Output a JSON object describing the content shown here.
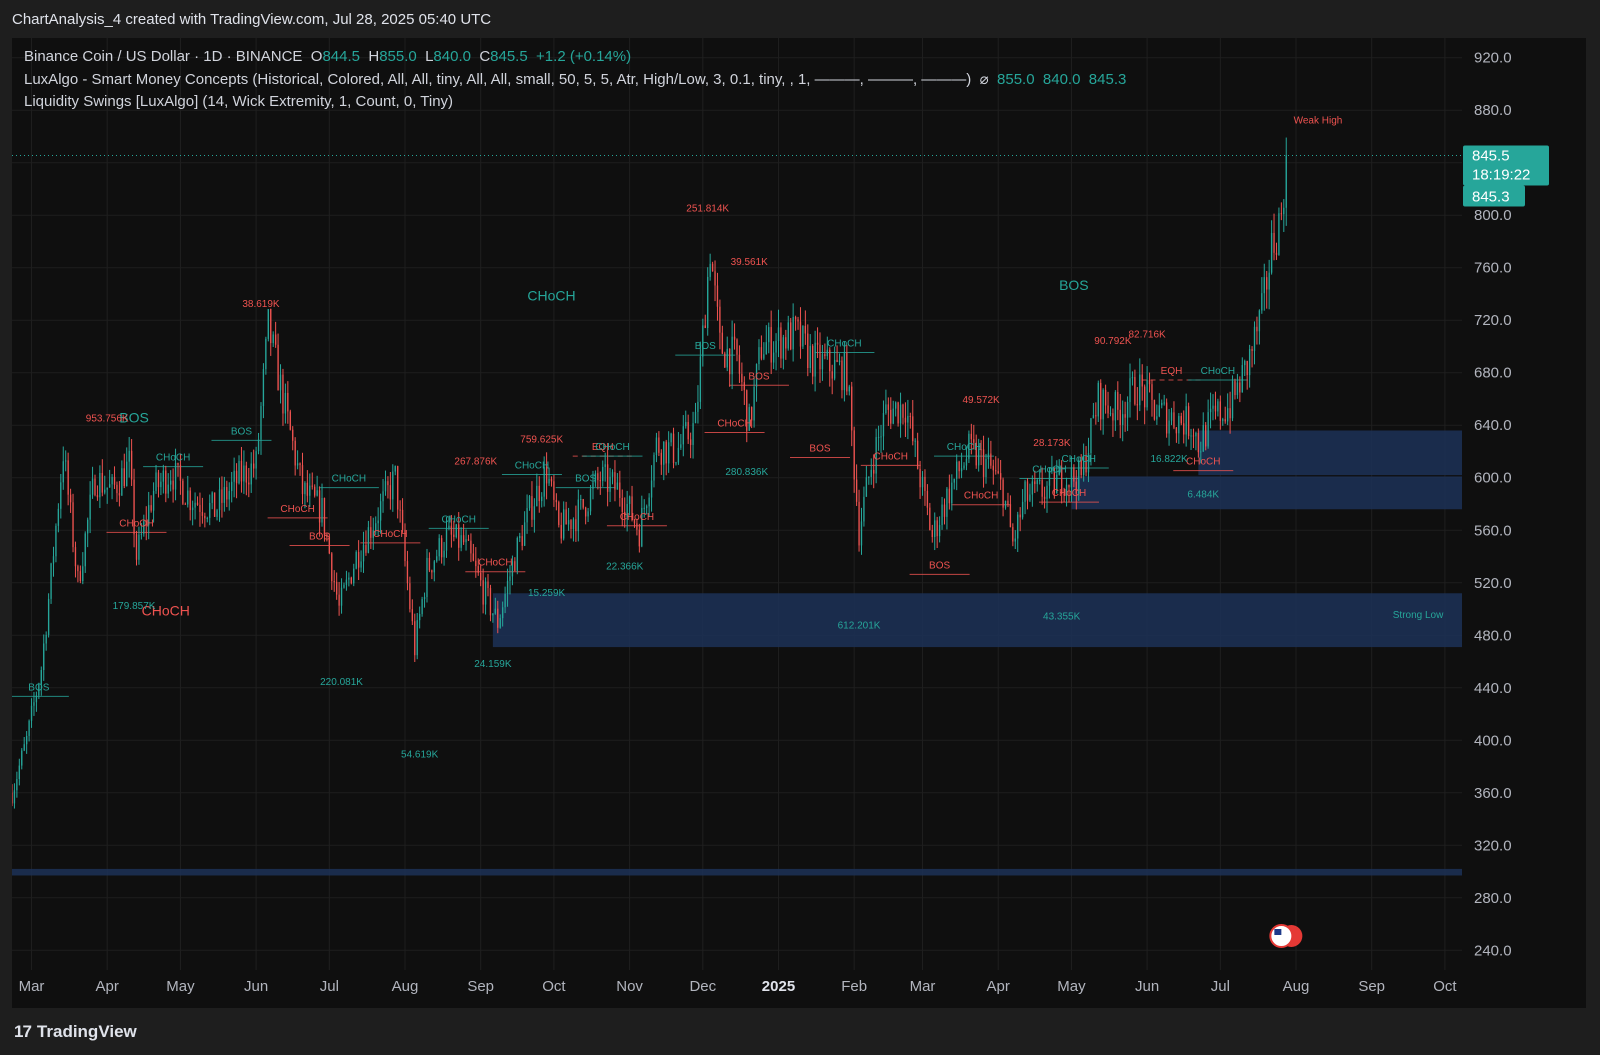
{
  "header": {
    "title": "ChartAnalysis_4 created with TradingView.com, Jul 28, 2025 05:40 UTC"
  },
  "legend": {
    "symbol": "Binance Coin / US Dollar · 1D · BINANCE",
    "open_label": "O",
    "open": "844.5",
    "high_label": "H",
    "high": "855.0",
    "low_label": "L",
    "low": "840.0",
    "close_label": "C",
    "close": "845.5",
    "change": "+1.2 (+0.14%)",
    "indicator1": "LuxAlgo - Smart Money Concepts (Historical, Colored, All, All, tiny, All, All, small, 50, 5, 5, Atr, High/Low, 3, 0.1, tiny, , 1, ———, ———, ———)",
    "indicator1_symbol": "⌀",
    "indicator1_values": [
      "855.0",
      "840.0",
      "845.3"
    ],
    "indicator2": "Liquidity Swings [LuxAlgo] (14, Wick Extremity, 1, Count, 0, Tiny)"
  },
  "price_badge": {
    "price": "845.5",
    "countdown": "18:19:22",
    "indicator_price": "845.3"
  },
  "footer": {
    "brand": "TradingView",
    "logo": "17"
  },
  "colors": {
    "up": "#26a69a",
    "down": "#ef5350",
    "zone": "#1c3157",
    "bg": "#0f0f0f",
    "grid": "#1f1f1f"
  },
  "chart_data": {
    "type": "candlestick",
    "symbol": "BNB/USD",
    "interval": "1D",
    "x_range": [
      "2024-02-22",
      "2025-10-08"
    ],
    "ylim": [
      225,
      935
    ],
    "y_ticks": [
      "920.0",
      "880.0",
      "840.0",
      "800.0",
      "760.0",
      "720.0",
      "680.0",
      "640.0",
      "600.0",
      "560.0",
      "520.0",
      "480.0",
      "440.0",
      "400.0",
      "360.0",
      "320.0",
      "280.0",
      "240.0"
    ],
    "y_tick_values": [
      920,
      880,
      840,
      800,
      760,
      720,
      680,
      640,
      600,
      560,
      520,
      480,
      440,
      400,
      360,
      320,
      280,
      240
    ],
    "x_ticks": [
      {
        "label": "Mar",
        "date": "2024-03-01"
      },
      {
        "label": "Apr",
        "date": "2024-04-01"
      },
      {
        "label": "May",
        "date": "2024-05-01"
      },
      {
        "label": "Jun",
        "date": "2024-06-01"
      },
      {
        "label": "Jul",
        "date": "2024-07-01"
      },
      {
        "label": "Aug",
        "date": "2024-08-01"
      },
      {
        "label": "Sep",
        "date": "2024-09-01"
      },
      {
        "label": "Oct",
        "date": "2024-10-01"
      },
      {
        "label": "Nov",
        "date": "2024-11-01"
      },
      {
        "label": "Dec",
        "date": "2024-12-01"
      },
      {
        "label": "2025",
        "date": "2025-01-01",
        "bold": true
      },
      {
        "label": "Feb",
        "date": "2025-02-01"
      },
      {
        "label": "Mar",
        "date": "2025-03-01"
      },
      {
        "label": "Apr",
        "date": "2025-04-01"
      },
      {
        "label": "May",
        "date": "2025-05-01"
      },
      {
        "label": "Jun",
        "date": "2025-06-01"
      },
      {
        "label": "Jul",
        "date": "2025-07-01"
      },
      {
        "label": "Aug",
        "date": "2025-08-01"
      },
      {
        "label": "Sep",
        "date": "2025-09-01"
      },
      {
        "label": "Oct",
        "date": "2025-10-01"
      }
    ],
    "last_price": 845.5,
    "price_path": [
      [
        "2024-02-22",
        360
      ],
      [
        "2024-02-28",
        400
      ],
      [
        "2024-03-05",
        455
      ],
      [
        "2024-03-09",
        525
      ],
      [
        "2024-03-14",
        620
      ],
      [
        "2024-03-20",
        520
      ],
      [
        "2024-03-27",
        600
      ],
      [
        "2024-04-03",
        590
      ],
      [
        "2024-04-10",
        610
      ],
      [
        "2024-04-13",
        540
      ],
      [
        "2024-04-20",
        590
      ],
      [
        "2024-04-27",
        605
      ],
      [
        "2024-05-05",
        585
      ],
      [
        "2024-05-15",
        575
      ],
      [
        "2024-05-25",
        600
      ],
      [
        "2024-06-01",
        610
      ],
      [
        "2024-06-06",
        715
      ],
      [
        "2024-06-12",
        660
      ],
      [
        "2024-06-20",
        590
      ],
      [
        "2024-06-28",
        575
      ],
      [
        "2024-07-05",
        500
      ],
      [
        "2024-07-12",
        540
      ],
      [
        "2024-07-20",
        570
      ],
      [
        "2024-07-28",
        600
      ],
      [
        "2024-08-05",
        470
      ],
      [
        "2024-08-10",
        530
      ],
      [
        "2024-08-18",
        555
      ],
      [
        "2024-08-25",
        550
      ],
      [
        "2024-09-03",
        510
      ],
      [
        "2024-09-08",
        490
      ],
      [
        "2024-09-15",
        540
      ],
      [
        "2024-09-22",
        580
      ],
      [
        "2024-09-28",
        605
      ],
      [
        "2024-10-03",
        560
      ],
      [
        "2024-10-12",
        575
      ],
      [
        "2024-10-20",
        600
      ],
      [
        "2024-10-28",
        590
      ],
      [
        "2024-11-05",
        560
      ],
      [
        "2024-11-12",
        625
      ],
      [
        "2024-11-20",
        620
      ],
      [
        "2024-11-28",
        640
      ],
      [
        "2024-12-04",
        775
      ],
      [
        "2024-12-08",
        700
      ],
      [
        "2024-12-15",
        690
      ],
      [
        "2024-12-20",
        640
      ],
      [
        "2024-12-25",
        700
      ],
      [
        "2025-01-02",
        705
      ],
      [
        "2025-01-08",
        710
      ],
      [
        "2025-01-15",
        690
      ],
      [
        "2025-01-22",
        685
      ],
      [
        "2025-01-29",
        680
      ],
      [
        "2025-02-03",
        560
      ],
      [
        "2025-02-08",
        610
      ],
      [
        "2025-02-14",
        650
      ],
      [
        "2025-02-22",
        655
      ],
      [
        "2025-02-28",
        600
      ],
      [
        "2025-03-05",
        555
      ],
      [
        "2025-03-12",
        590
      ],
      [
        "2025-03-20",
        620
      ],
      [
        "2025-03-28",
        610
      ],
      [
        "2025-04-03",
        590
      ],
      [
        "2025-04-07",
        550
      ],
      [
        "2025-04-12",
        585
      ],
      [
        "2025-04-20",
        590
      ],
      [
        "2025-04-27",
        600
      ],
      [
        "2025-05-05",
        600
      ],
      [
        "2025-05-12",
        660
      ],
      [
        "2025-05-20",
        650
      ],
      [
        "2025-05-28",
        670
      ],
      [
        "2025-06-05",
        650
      ],
      [
        "2025-06-13",
        645
      ],
      [
        "2025-06-20",
        640
      ],
      [
        "2025-06-22",
        625
      ],
      [
        "2025-06-28",
        645
      ],
      [
        "2025-07-05",
        655
      ],
      [
        "2025-07-12",
        685
      ],
      [
        "2025-07-18",
        725
      ],
      [
        "2025-07-22",
        775
      ],
      [
        "2025-07-26",
        800
      ],
      [
        "2025-07-28",
        845.5
      ]
    ],
    "annotations": [
      {
        "date": "2024-04-12",
        "price": 642,
        "text": "BOS",
        "color": "up",
        "size": "big"
      },
      {
        "date": "2024-04-25",
        "price": 495,
        "text": "CHoCH",
        "color": "down",
        "size": "big"
      },
      {
        "date": "2024-09-30",
        "price": 735,
        "text": "CHoCH",
        "color": "up",
        "size": "big"
      },
      {
        "date": "2025-05-02",
        "price": 743,
        "text": "BOS",
        "color": "up",
        "size": "big"
      },
      {
        "date": "2024-03-04",
        "price": 438,
        "text": "BOS",
        "color": "up"
      },
      {
        "date": "2024-04-13",
        "price": 563,
        "text": "CHoCH",
        "color": "down"
      },
      {
        "date": "2024-04-28",
        "price": 613,
        "text": "CHoCH",
        "color": "up"
      },
      {
        "date": "2024-05-26",
        "price": 633,
        "text": "BOS",
        "color": "up"
      },
      {
        "date": "2024-06-18",
        "price": 574,
        "text": "CHoCH",
        "color": "down"
      },
      {
        "date": "2024-06-27",
        "price": 553,
        "text": "BOS",
        "color": "down"
      },
      {
        "date": "2024-07-09",
        "price": 597,
        "text": "CHoCH",
        "color": "up"
      },
      {
        "date": "2024-07-26",
        "price": 555,
        "text": "CHoCH",
        "color": "down"
      },
      {
        "date": "2024-08-23",
        "price": 566,
        "text": "CHoCH",
        "color": "up"
      },
      {
        "date": "2024-09-07",
        "price": 533,
        "text": "CHoCH",
        "color": "down"
      },
      {
        "date": "2024-09-22",
        "price": 607,
        "text": "CHoCH",
        "color": "up"
      },
      {
        "date": "2024-10-21",
        "price": 621,
        "text": "EQH",
        "color": "down"
      },
      {
        "date": "2024-10-14",
        "price": 597,
        "text": "BOS",
        "color": "up"
      },
      {
        "date": "2024-10-25",
        "price": 621,
        "text": "CHoCH",
        "color": "up"
      },
      {
        "date": "2024-11-04",
        "price": 568,
        "text": "CHoCH",
        "color": "down"
      },
      {
        "date": "2024-12-02",
        "price": 698,
        "text": "BOS",
        "color": "up"
      },
      {
        "date": "2024-12-14",
        "price": 639,
        "text": "CHoCH",
        "color": "down"
      },
      {
        "date": "2024-12-24",
        "price": 675,
        "text": "BOS",
        "color": "down"
      },
      {
        "date": "2025-01-18",
        "price": 620,
        "text": "BOS",
        "color": "down"
      },
      {
        "date": "2025-01-28",
        "price": 700,
        "text": "CHoCH",
        "color": "up"
      },
      {
        "date": "2025-02-16",
        "price": 614,
        "text": "CHoCH",
        "color": "down"
      },
      {
        "date": "2025-03-18",
        "price": 621,
        "text": "CHoCH",
        "color": "up"
      },
      {
        "date": "2025-03-08",
        "price": 531,
        "text": "BOS",
        "color": "down"
      },
      {
        "date": "2025-03-25",
        "price": 584,
        "text": "CHoCH",
        "color": "down"
      },
      {
        "date": "2025-04-22",
        "price": 604,
        "text": "CHoCH",
        "color": "up"
      },
      {
        "date": "2025-05-04",
        "price": 612,
        "text": "CHoCH",
        "color": "up"
      },
      {
        "date": "2025-04-30",
        "price": 586,
        "text": "CHoCH",
        "color": "down"
      },
      {
        "date": "2025-06-11",
        "price": 679,
        "text": "EQH",
        "color": "down"
      },
      {
        "date": "2025-06-30",
        "price": 679,
        "text": "CHoCH",
        "color": "up"
      },
      {
        "date": "2025-06-24",
        "price": 610,
        "text": "CHoCH",
        "color": "down"
      }
    ],
    "liquidity_labels": [
      {
        "date": "2024-06-03",
        "price": 730,
        "text": "38.619K",
        "color": "down"
      },
      {
        "date": "2024-04-01",
        "price": 643,
        "text": "953.756K",
        "color": "down"
      },
      {
        "date": "2024-04-12",
        "price": 500,
        "text": "179.857K",
        "color": "up"
      },
      {
        "date": "2024-07-06",
        "price": 442,
        "text": "220.081K",
        "color": "up"
      },
      {
        "date": "2024-08-07",
        "price": 387,
        "text": "54.619K",
        "color": "up"
      },
      {
        "date": "2024-08-30",
        "price": 610,
        "text": "267.876K",
        "color": "down"
      },
      {
        "date": "2024-09-06",
        "price": 456,
        "text": "24.159K",
        "color": "up"
      },
      {
        "date": "2024-09-28",
        "price": 510,
        "text": "15.259K",
        "color": "up"
      },
      {
        "date": "2024-09-26",
        "price": 627,
        "text": "759.625K",
        "color": "down"
      },
      {
        "date": "2024-10-30",
        "price": 530,
        "text": "22.366K",
        "color": "up"
      },
      {
        "date": "2024-12-03",
        "price": 803,
        "text": "251.814K",
        "color": "down"
      },
      {
        "date": "2024-12-20",
        "price": 762,
        "text": "39.561K",
        "color": "down"
      },
      {
        "date": "2024-12-19",
        "price": 602,
        "text": "280.836K",
        "color": "up"
      },
      {
        "date": "2025-02-03",
        "price": 485,
        "text": "612.201K",
        "color": "up"
      },
      {
        "date": "2025-03-25",
        "price": 657,
        "text": "49.572K",
        "color": "down"
      },
      {
        "date": "2025-04-27",
        "price": 492,
        "text": "43.355K",
        "color": "up"
      },
      {
        "date": "2025-04-23",
        "price": 624,
        "text": "28.173K",
        "color": "down"
      },
      {
        "date": "2025-05-18",
        "price": 702,
        "text": "90.792K",
        "color": "down"
      },
      {
        "date": "2025-06-01",
        "price": 707,
        "text": "82.716K",
        "color": "down"
      },
      {
        "date": "2025-06-10",
        "price": 612,
        "text": "16.822K",
        "color": "up"
      },
      {
        "date": "2025-06-24",
        "price": 585,
        "text": "6.484K",
        "color": "up"
      },
      {
        "date": "2025-08-10",
        "price": 870,
        "text": "Weak High",
        "color": "down"
      },
      {
        "date": "2025-09-20",
        "price": 493,
        "text": "Strong Low",
        "color": "up"
      }
    ],
    "zones": [
      {
        "from": "2024-02-22",
        "to": "2025-10-08",
        "top": 302,
        "bottom": 297
      },
      {
        "from": "2024-09-06",
        "to": "2025-10-08",
        "top": 512,
        "bottom": 471
      },
      {
        "from": "2025-06-22",
        "to": "2025-10-08",
        "top": 636,
        "bottom": 602
      },
      {
        "from": "2025-05-01",
        "to": "2025-10-08",
        "top": 601,
        "bottom": 576
      }
    ]
  }
}
